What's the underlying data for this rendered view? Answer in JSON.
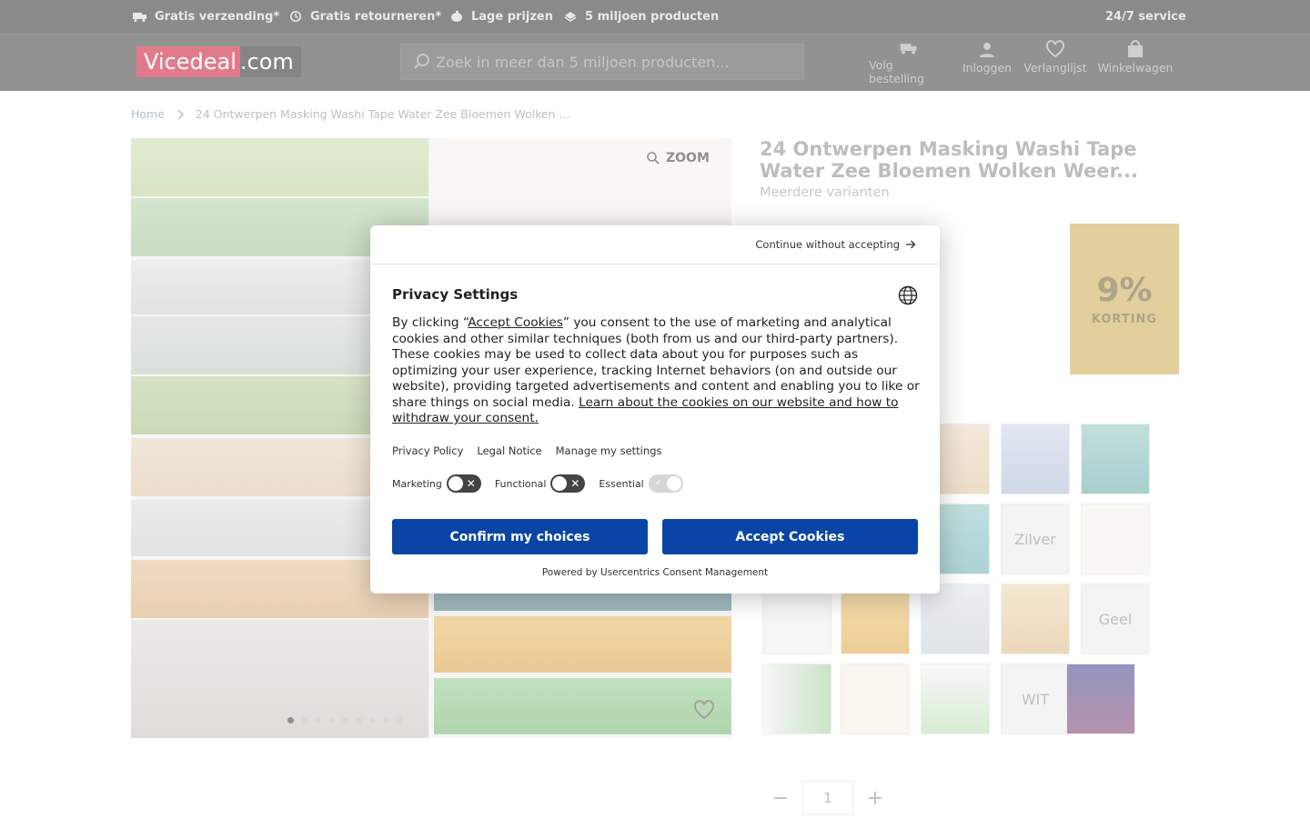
{
  "topbar": {
    "usps": [
      "Gratis verzending*",
      "Gratis retourneren*",
      "Lage prijzen",
      "5 miljoen producten"
    ],
    "service": "24/7 service"
  },
  "header": {
    "logo_left": "Vicedeal",
    "logo_right": ".com",
    "search_placeholder": "Zoek in meer dan 5 miljoen producten...",
    "nav": [
      "Volg bestelling",
      "Inloggen",
      "Verlanglijst",
      "Winkelwagen"
    ]
  },
  "breadcrumb": {
    "home": "Home",
    "current": "24 Ontwerpen Masking Washi Tape Water Zee Bloemen Wolken ..."
  },
  "product": {
    "title": "24 Ontwerpen Masking Washi Tape Water Zee Bloemen Wolken Weer...",
    "variants_link": "Meerdere varianten",
    "zoom_label": "ZOOM",
    "discount_pct": "9%",
    "discount_label": "KORTING",
    "quantity": "1",
    "color_variants": [
      "Zilver",
      "Geel",
      "WIT"
    ]
  },
  "cookie_modal": {
    "continue_label": "Continue without accepting",
    "title": "Privacy Settings",
    "body_before": "By clicking “",
    "body_link1": "Accept Cookies",
    "body_middle": "” you consent to the use of marketing and analytical cookies and other similar techniques (both from us and our third-party partners). These cookies may be used to collect data about you for purposes such as optimizing your user experience, tracking Internet behaviors (on and outside our website), providing targeted advertisements and content and enabling you to like or share things on social media. ",
    "body_link2": "Learn about the cookies on our website and how to withdraw your consent.",
    "links": [
      "Privacy Policy",
      "Legal Notice",
      "Manage my settings"
    ],
    "toggles": [
      {
        "label": "Marketing",
        "state": "off"
      },
      {
        "label": "Functional",
        "state": "off"
      },
      {
        "label": "Essential",
        "state": "on"
      }
    ],
    "confirm_label": "Confirm my choices",
    "accept_label": "Accept Cookies",
    "powered_by": "Powered by Usercentrics Consent Management"
  },
  "colors": {
    "accent_blue": "#0a45a6",
    "discount_yellow": "#f2c53d",
    "topbar": "#2b2b2b",
    "logo_red": "#c8102e"
  }
}
